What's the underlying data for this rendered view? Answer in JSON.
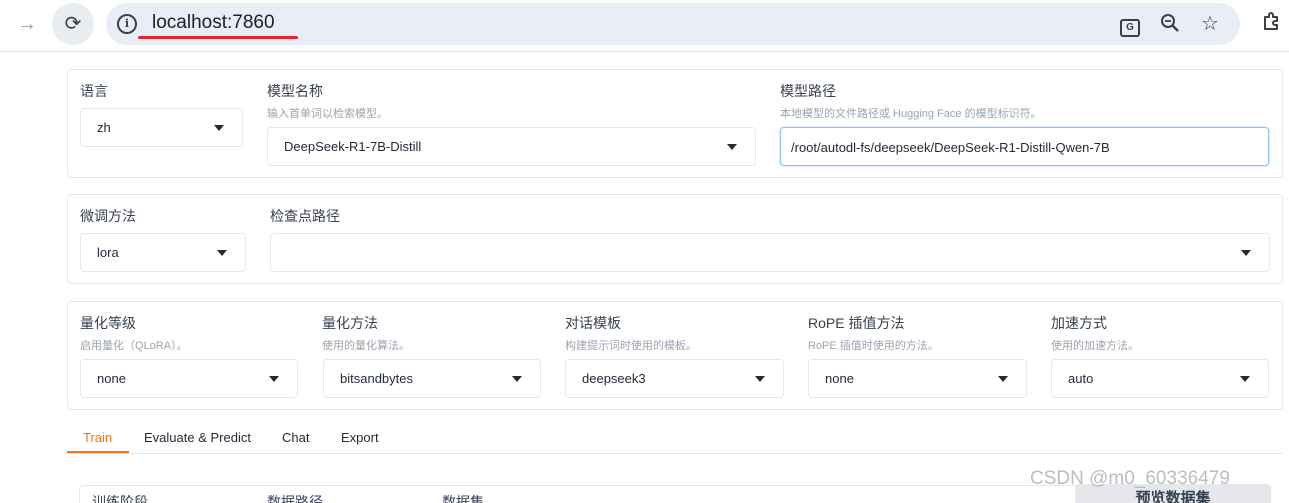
{
  "browser": {
    "url": "localhost:7860",
    "icons": {
      "forward": "arrow-right-icon",
      "reload": "reload-icon",
      "site_info": "info-icon",
      "translate": "translate-icon",
      "zoom": "zoom-icon",
      "bookmark": "star-icon",
      "extensions": "puzzle-icon"
    },
    "highlight_color": "#e6262d"
  },
  "model_row": {
    "language": {
      "label": "语言",
      "value": "zh"
    },
    "model_name": {
      "label": "模型名称",
      "info": "输入首单词以检索模型。",
      "value": "DeepSeek-R1-7B-Distill"
    },
    "model_path": {
      "label": "模型路径",
      "info": "本地模型的文件路径或 Hugging Face 的模型标识符。",
      "value": "/root/autodl-fs/deepseek/DeepSeek-R1-Distill-Qwen-7B"
    }
  },
  "finetune_row": {
    "method": {
      "label": "微调方法",
      "value": "lora"
    },
    "checkpoint": {
      "label": "检查点路径",
      "value": ""
    }
  },
  "advanced_row": {
    "quant_bit": {
      "label": "量化等级",
      "info": "启用量化（QLoRA）。",
      "value": "none"
    },
    "quant_method": {
      "label": "量化方法",
      "info": "使用的量化算法。",
      "value": "bitsandbytes"
    },
    "template": {
      "label": "对话模板",
      "info": "构建提示词时使用的模板。",
      "value": "deepseek3"
    },
    "rope": {
      "label": "RoPE 插值方法",
      "info": "RoPE 插值时使用的方法。",
      "value": "none"
    },
    "booster": {
      "label": "加速方式",
      "info": "使用的加速方法。",
      "value": "auto"
    }
  },
  "tabs": [
    {
      "label": "Train",
      "active": true
    },
    {
      "label": "Evaluate & Predict",
      "active": false
    },
    {
      "label": "Chat",
      "active": false
    },
    {
      "label": "Export",
      "active": false
    }
  ],
  "accent_color": "#f97316",
  "bottom": {
    "training_stage": "训练阶段",
    "data_dir": "数据路径",
    "dataset": "数据集",
    "preview_button": "预览数据集"
  },
  "watermark": "CSDN @m0_60336479"
}
